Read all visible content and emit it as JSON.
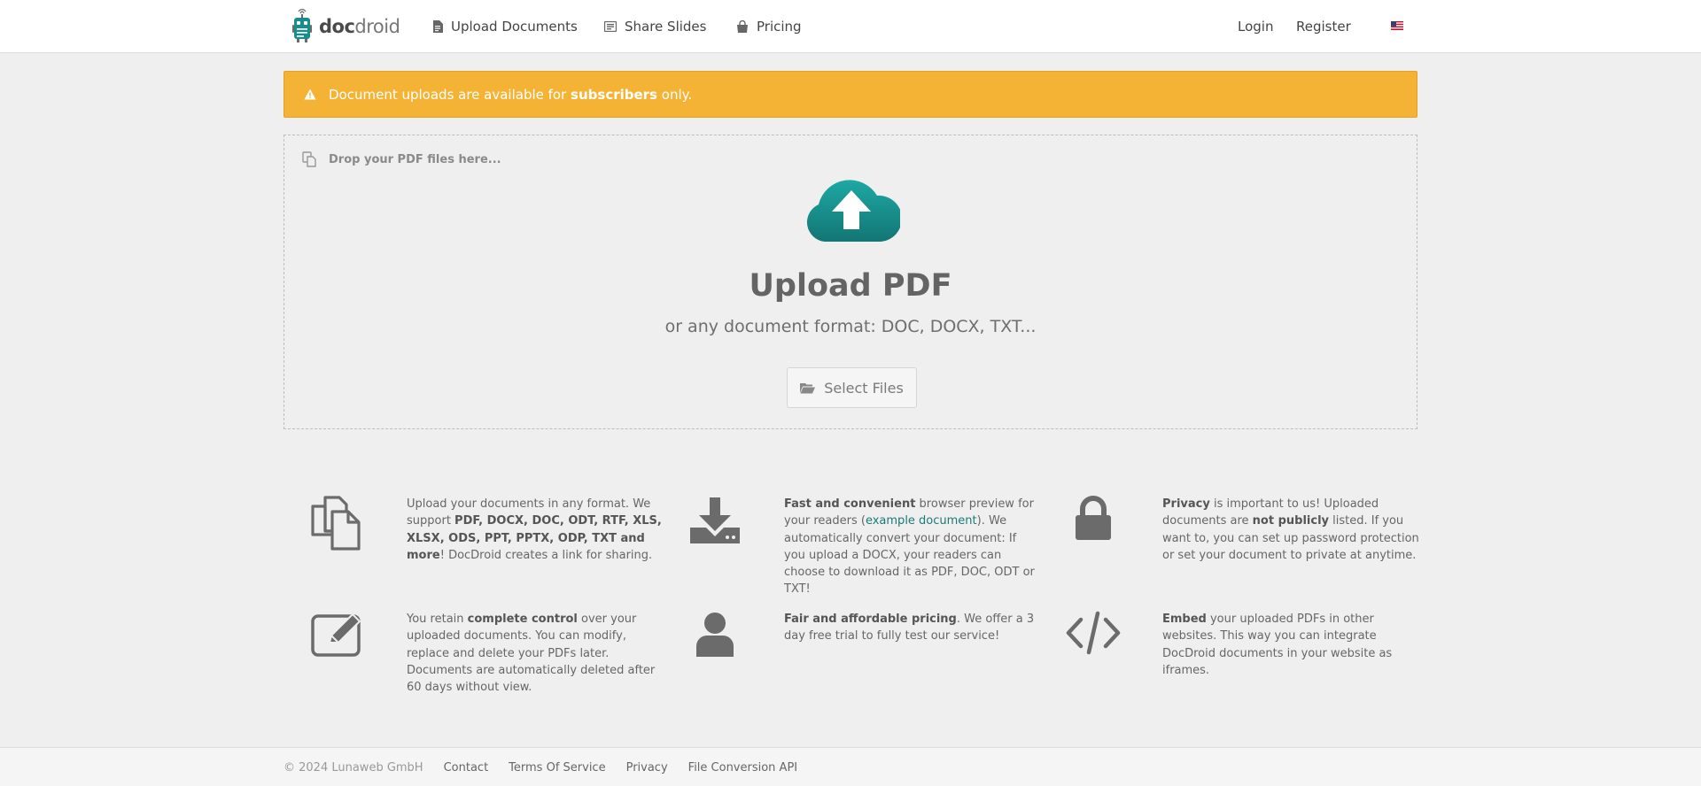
{
  "header": {
    "logo_bold": "doc",
    "logo_light": "droid",
    "nav": [
      {
        "label": "Upload Documents",
        "icon": "document-icon"
      },
      {
        "label": "Share Slides",
        "icon": "slides-icon"
      },
      {
        "label": "Pricing",
        "icon": "shopping-bag-icon"
      }
    ],
    "login": "Login",
    "register": "Register",
    "language_icon": "us-flag-icon"
  },
  "alert": {
    "prefix": "Document uploads are available for ",
    "bold": "subscribers",
    "suffix": " only.",
    "color": "#f5b335"
  },
  "upload": {
    "hint": "Drop your PDF files here...",
    "title": "Upload PDF",
    "subtitle": "or any document format: DOC, DOCX, TXT...",
    "button": "Select Files",
    "accent": "#1a8c8a"
  },
  "features": {
    "formats": {
      "t1": "Upload your documents in any format. We support ",
      "b1": "PDF, DOCX, DOC, ODT, RTF, XLS, XLSX, ODS, PPT, PPTX, ODP, TXT and more",
      "t2": "! DocDroid creates a link for sharing."
    },
    "preview": {
      "b1": "Fast and convenient",
      "t1": " browser preview for your readers (",
      "link": "example document",
      "t2": "). We automatically convert your document: If you upload a DOCX, your readers can choose to download it as PDF, DOC, ODT or TXT!"
    },
    "privacy": {
      "b1": "Privacy",
      "t1": " is important to us! Uploaded documents are ",
      "b2": "not publicly",
      "t2": " listed. If you want to, you can set up password protection or set your document to private at anytime."
    },
    "control": {
      "t1": "You retain ",
      "b1": "complete control",
      "t2": " over your uploaded documents. You can modify, replace and delete your PDFs later. Documents are automatically deleted after 60 days without view."
    },
    "pricing": {
      "b1": "Fair and affordable pricing",
      "t1": ". We offer a 3 day free trial to fully test our service!"
    },
    "embed": {
      "b1": "Embed",
      "t1": " your uploaded PDFs in other websites. This way you can integrate DocDroid documents in your website as iframes."
    }
  },
  "footer": {
    "copyright": "© 2024 Lunaweb GmbH",
    "links": [
      "Contact",
      "Terms Of Service",
      "Privacy",
      "File Conversion API"
    ]
  }
}
